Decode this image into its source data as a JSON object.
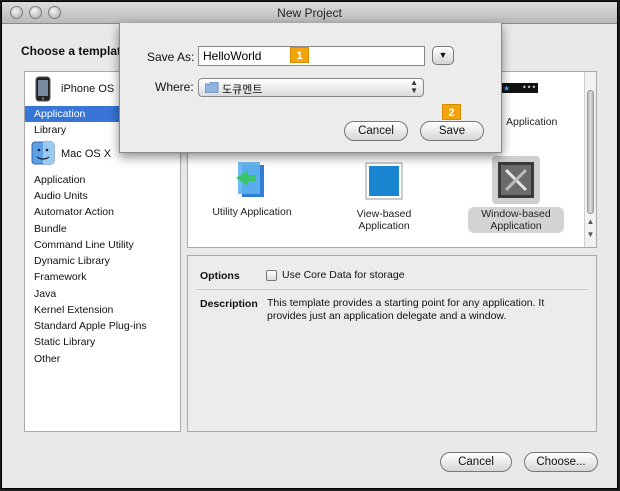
{
  "window": {
    "title": "New Project"
  },
  "main": {
    "choose_label": "Choose a template"
  },
  "sidebar": {
    "groups": [
      {
        "label": "iPhone OS",
        "items": [
          "Application",
          "Library"
        ]
      },
      {
        "label": "Mac OS X",
        "items": [
          "Application",
          "Audio Units",
          "Automator Action",
          "Bundle",
          "Command Line Utility",
          "Dynamic Library",
          "Framework",
          "Java",
          "Kernel Extension",
          "Standard Apple Plug-ins",
          "Static Library",
          "Other"
        ]
      }
    ],
    "selected": "iPhone OS / Application"
  },
  "templates": [
    {
      "label": "Utility Application",
      "icon": "utility-app-icon"
    },
    {
      "label": "View-based Application",
      "icon": "view-based-app-icon"
    },
    {
      "label": "Window-based Application",
      "icon": "window-based-app-icon",
      "selected": true
    },
    {
      "label": "Application",
      "partial": true
    }
  ],
  "details": {
    "options_label": "Options",
    "core_data_label": "Use Core Data for storage",
    "core_data_checked": false,
    "description_label": "Description",
    "description_text": "This template provides a starting point for any application. It provides just an application delegate and a window."
  },
  "footer": {
    "cancel": "Cancel",
    "choose": "Choose..."
  },
  "save_sheet": {
    "save_as_label": "Save As:",
    "save_as_value": "HelloWorld",
    "where_label": "Where:",
    "where_value": "도큐멘트",
    "cancel": "Cancel",
    "save": "Save",
    "badge_1": "1",
    "badge_2": "2"
  },
  "colors": {
    "selection": "#3875d7",
    "badge": "#f2a40c"
  }
}
